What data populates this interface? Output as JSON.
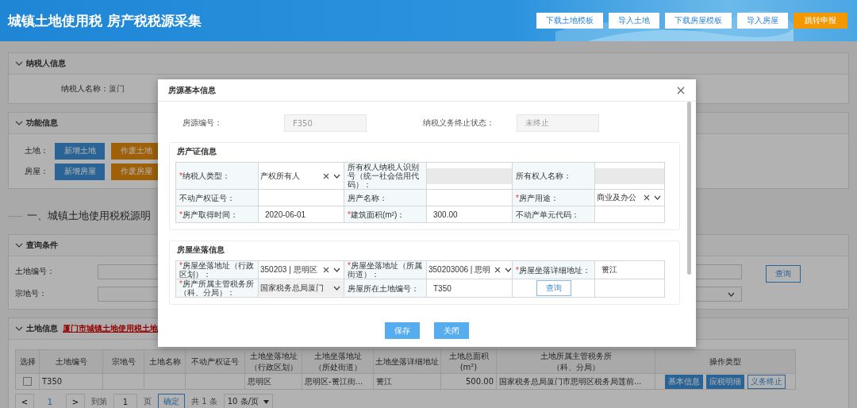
{
  "header": {
    "title": "城镇土地使用税 房产税税源采集",
    "buttons": [
      {
        "label": "下载土地模板",
        "kind": "plain"
      },
      {
        "label": "导入土地",
        "kind": "plain"
      },
      {
        "label": "下载房屋模板",
        "kind": "plain"
      },
      {
        "label": "导入房屋",
        "kind": "plain"
      },
      {
        "label": "跳转申报",
        "kind": "accent"
      }
    ]
  },
  "taxpayer_section": {
    "title": "纳税人信息",
    "fields": [
      {
        "label": "纳税人名称：",
        "value": "厦门"
      }
    ]
  },
  "function_section": {
    "title": "功能信息",
    "rows": [
      {
        "label": "土地：",
        "buttons": [
          {
            "label": "新增土地",
            "kind": "add"
          },
          {
            "label": "作废土地",
            "kind": "void"
          }
        ]
      },
      {
        "label": "房屋：",
        "buttons": [
          {
            "label": "新增房屋",
            "kind": "add"
          },
          {
            "label": "作废房屋",
            "kind": "void"
          }
        ]
      }
    ]
  },
  "section_heading": "一、城镇土地使用税税源明",
  "query_section": {
    "title": "查询条件",
    "fields": [
      {
        "label": "土地编号：",
        "kind": "text"
      },
      {
        "label": "宗地号：",
        "kind": "select"
      }
    ],
    "search_button": "查询"
  },
  "land_section": {
    "title": "土地信息",
    "link": "厦门市城镇土地使用税土地",
    "table": {
      "columns": [
        "选择",
        "土地编号",
        "宗地号",
        "土地名称",
        "不动产权证号",
        "土地坐落地址（行政区划）",
        "土地坐落地址（所处街道）",
        "土地坐落详细地址",
        "土地总面积(m²)",
        "土地所属主管税务所（科、分局）",
        "操作类型"
      ],
      "rows": [
        {
          "selected": false,
          "cells": [
            "",
            "T350",
            "",
            "",
            "",
            "思明区",
            "思明区-篑江街...",
            "篑江",
            "500.00",
            "国家税务总局厦门市思明区税务局莲前..."
          ],
          "actions": [
            {
              "label": "基本信息",
              "kind": "solid"
            },
            {
              "label": "应税明细",
              "kind": "solid"
            },
            {
              "label": "义务终止",
              "kind": "outline"
            }
          ]
        }
      ]
    },
    "pagination": {
      "prev": "<",
      "pages": [
        {
          "label": "1",
          "selected": true
        }
      ],
      "next": ">",
      "goto_label": "到第",
      "goto_value": "1",
      "page_unit": "页",
      "confirm": "确定",
      "total": "共 1 条",
      "page_size": "10 条/页"
    }
  },
  "dialog": {
    "title": "房源基本信息",
    "top_fields": [
      {
        "label": "房源编号：",
        "value": "F350"
      },
      {
        "label": "纳税义务终止状态：",
        "value": "未终止"
      }
    ],
    "groups": [
      {
        "title": "房产证信息",
        "rows": [
          [
            {
              "kind": "label",
              "required": "*",
              "text": "纳税人类型："
            },
            {
              "kind": "select",
              "value": "产权所有人",
              "clearable": true
            },
            {
              "kind": "label",
              "text": "所有权人纳税人识别号（统一社会信用代码）："
            },
            {
              "kind": "input",
              "disabled": true
            },
            {
              "kind": "label",
              "text": "所有权人名称："
            },
            {
              "kind": "input",
              "disabled": true
            }
          ],
          [
            {
              "kind": "label",
              "text": "不动产权证号："
            },
            {
              "kind": "input",
              "disabled": false
            },
            {
              "kind": "label",
              "text": "房产名称："
            },
            {
              "kind": "input",
              "disabled": false
            },
            {
              "kind": "label",
              "required": "*",
              "text": "房产用途："
            },
            {
              "kind": "select",
              "value": "商业及办公",
              "clearable": true
            }
          ],
          [
            {
              "kind": "label",
              "required": "*",
              "text": "房产取得时间："
            },
            {
              "kind": "input",
              "value": "2020-06-01",
              "disabled": false
            },
            {
              "kind": "label",
              "required": "*",
              "text": "建筑面积(m²)："
            },
            {
              "kind": "input",
              "value": "300.00",
              "disabled": false
            },
            {
              "kind": "label",
              "text": "不动产单元代码："
            },
            {
              "kind": "input",
              "disabled": false
            }
          ]
        ]
      },
      {
        "title": "房屋坐落信息",
        "rows": [
          [
            {
              "kind": "label",
              "required": "*",
              "text": "房屋坐落地址（行政区划）："
            },
            {
              "kind": "select",
              "value": "350203 | 思明区",
              "clearable": true
            },
            {
              "kind": "label",
              "required": "*",
              "text": "房屋坐落地址（所属街道）："
            },
            {
              "kind": "select",
              "value": "350203006 | 思明",
              "clearable": true
            },
            {
              "kind": "label",
              "required": "*",
              "text": "房屋坐落详细地址："
            },
            {
              "kind": "input",
              "value": "篑江",
              "disabled": false
            }
          ],
          [
            {
              "kind": "label",
              "required": "*",
              "text": "房产所属主管税务所（科、分局）："
            },
            {
              "kind": "select",
              "value": "国家税务总局厦门",
              "clearable": false
            },
            {
              "kind": "label",
              "text": "房屋所在土地编号："
            },
            {
              "kind": "input",
              "value": "T350",
              "disabled": false
            },
            {
              "kind": "button",
              "text": "查询"
            },
            {
              "kind": "empty"
            }
          ]
        ]
      }
    ],
    "buttons": [
      {
        "label": "保存"
      },
      {
        "label": "关闭"
      }
    ]
  }
}
